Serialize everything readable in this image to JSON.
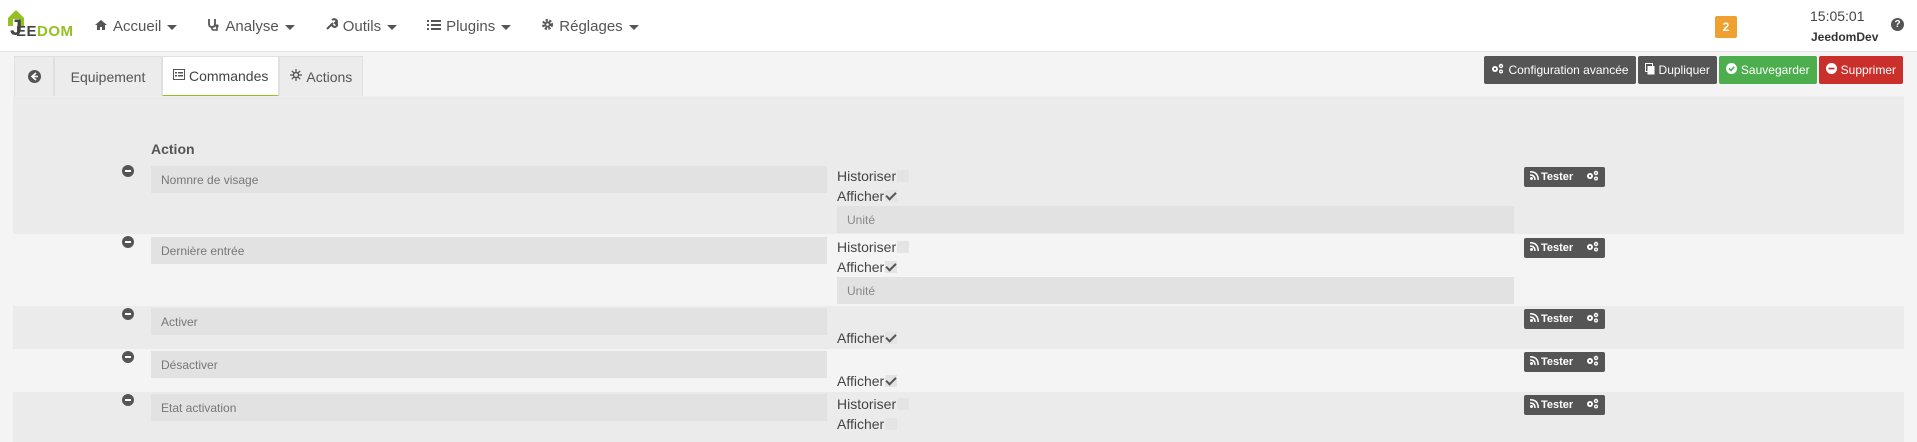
{
  "brand": {
    "logo_j": "J",
    "logo_ee": "EE",
    "logo_dom": "DOM"
  },
  "nav": [
    {
      "label": "Accueil",
      "icon": "home-icon"
    },
    {
      "label": "Analyse",
      "icon": "stethoscope-icon"
    },
    {
      "label": "Outils",
      "icon": "wrench-icon"
    },
    {
      "label": "Plugins",
      "icon": "list-icon"
    },
    {
      "label": "Réglages",
      "icon": "gear-icon"
    }
  ],
  "header": {
    "badge_count": "2",
    "time": "15:05:01",
    "user": "JeedomDev",
    "help": "?"
  },
  "tabs": {
    "equipement": "Equipement",
    "commandes": "Commandes",
    "actions": "Actions"
  },
  "toolbar": {
    "config": "Configuration avancée",
    "dupliquer": "Dupliquer",
    "sauvegarder": "Sauvegarder",
    "supprimer": "Supprimer"
  },
  "colors": {
    "accent": "#94c11f",
    "danger": "#c9302c",
    "success": "#4cae4c",
    "dark": "#555555",
    "badge": "#f0a030"
  },
  "table": {
    "column_header": "Action",
    "historiser_label": "Historiser",
    "afficher_label": "Afficher",
    "tester_label": "Tester",
    "commands": [
      {
        "name": "Nomnre de visage",
        "historiser": false,
        "afficher": true,
        "unit_placeholder": "Unité"
      },
      {
        "name": "Dernière entrée",
        "historiser": false,
        "afficher": true,
        "unit_placeholder": "Unité"
      },
      {
        "name": "Activer",
        "afficher": true
      },
      {
        "name": "Désactiver",
        "afficher": true
      },
      {
        "name": "Etat activation",
        "historiser": false,
        "afficher": false
      }
    ]
  }
}
